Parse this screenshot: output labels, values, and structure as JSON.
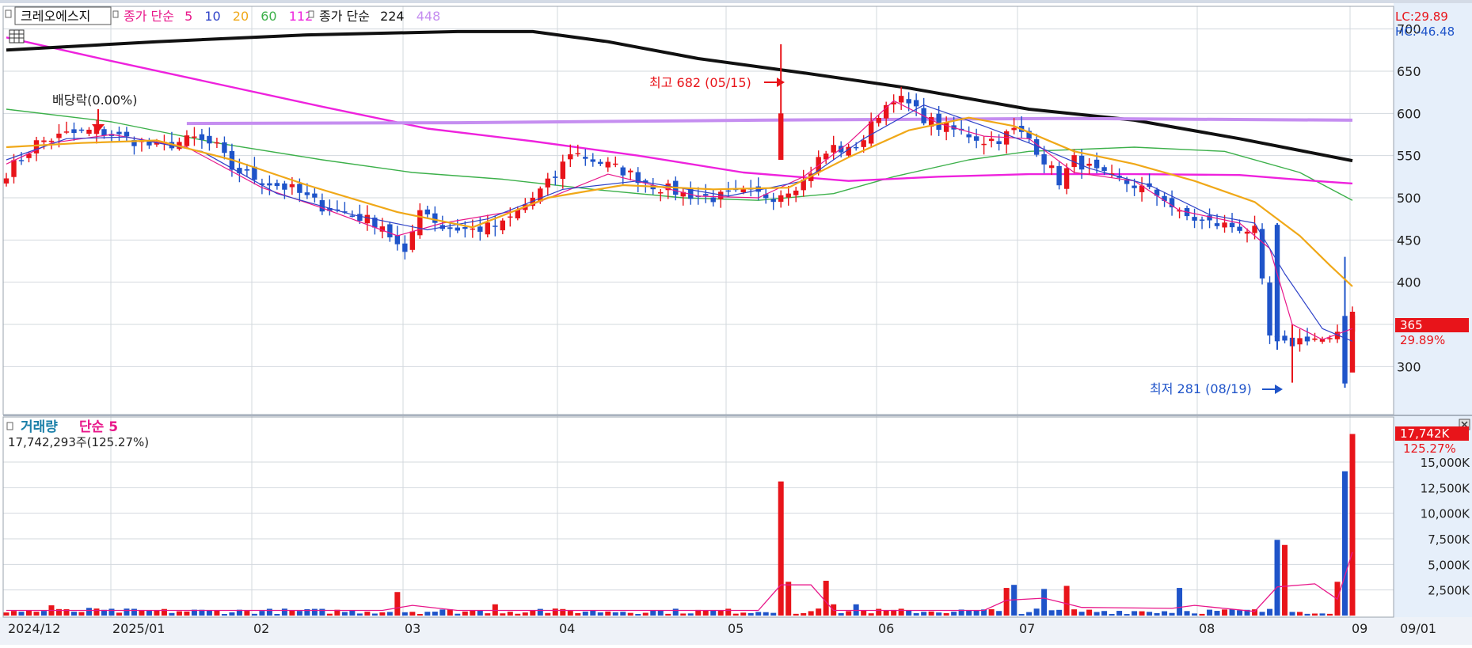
{
  "price_panel": {
    "stock_name": "크레오에스지",
    "ma_label_1": "종가 단순",
    "ma_periods_1": [
      "5",
      "10",
      "20",
      "60",
      "112"
    ],
    "ma_label_2": "종가 단순",
    "ma_periods_2": [
      "224",
      "448"
    ],
    "lc_label": "LC:29.89",
    "hc_label": "HC:-46.48",
    "dividend_label": "배당락(0.00%)",
    "high_label": "최고 682 (05/15)",
    "low_label": "최저 281 (08/19)",
    "current_price": "365",
    "current_change": "29.89%"
  },
  "volume_panel": {
    "title": "거래량",
    "ma_label": "단순 5",
    "summary": "17,742,293주(125.27%)",
    "current_volume": "17,742K",
    "current_ratio": "125.27%"
  },
  "colors": {
    "up": "#e8141a",
    "down": "#1f54c9",
    "ma5": "#e8178a",
    "ma10": "#2f43c8",
    "ma20": "#f0a818",
    "ma60": "#3cb04a",
    "ma112": "#ee22dd",
    "ma224": "#111111",
    "ma448": "#c58ef0"
  },
  "chart_data": [
    {
      "type": "candlestick",
      "title": "크레오에스지",
      "y_ticks": [
        300,
        350,
        400,
        450,
        500,
        550,
        600,
        650,
        700
      ],
      "y_tick_labels": [
        "300",
        "",
        "400",
        "450",
        "500",
        "550",
        "600",
        "650",
        "700"
      ],
      "ylim": [
        245,
        725
      ],
      "x_tick_labels": [
        "2024/12",
        "2025/01",
        "02",
        "03",
        "04",
        "05",
        "06",
        "07",
        "08",
        "09",
        "09/01"
      ],
      "grid": true,
      "bars": 180,
      "price_anchors": [
        [
          0,
          530
        ],
        [
          4,
          565
        ],
        [
          8,
          575
        ],
        [
          12,
          580
        ],
        [
          16,
          570
        ],
        [
          20,
          560
        ],
        [
          25,
          570
        ],
        [
          28,
          560
        ],
        [
          30,
          535
        ],
        [
          34,
          520
        ],
        [
          38,
          510
        ],
        [
          42,
          490
        ],
        [
          46,
          480
        ],
        [
          50,
          468
        ],
        [
          53,
          430
        ],
        [
          55,
          490
        ],
        [
          58,
          465
        ],
        [
          62,
          462
        ],
        [
          66,
          468
        ],
        [
          70,
          500
        ],
        [
          73,
          525
        ],
        [
          75,
          555
        ],
        [
          78,
          545
        ],
        [
          82,
          532
        ],
        [
          86,
          515
        ],
        [
          90,
          505
        ],
        [
          94,
          500
        ],
        [
          98,
          505
        ],
        [
          102,
          502
        ],
        [
          106,
          520
        ],
        [
          108,
          545
        ],
        [
          110,
          560
        ],
        [
          112,
          555
        ],
        [
          114,
          570
        ],
        [
          116,
          600
        ],
        [
          118,
          620
        ],
        [
          120,
          610
        ],
        [
          122,
          595
        ],
        [
          124,
          585
        ],
        [
          126,
          580
        ],
        [
          128,
          575
        ],
        [
          130,
          568
        ],
        [
          132,
          570
        ],
        [
          134,
          580
        ],
        [
          136,
          570
        ],
        [
          138,
          545
        ],
        [
          140,
          520
        ],
        [
          142,
          545
        ],
        [
          146,
          525
        ],
        [
          150,
          515
        ],
        [
          154,
          500
        ],
        [
          156,
          480
        ],
        [
          160,
          470
        ],
        [
          164,
          465
        ],
        [
          166,
          460
        ],
        [
          168,
          335
        ],
        [
          170,
          325
        ],
        [
          173,
          335
        ],
        [
          176,
          330
        ],
        [
          178,
          340
        ],
        [
          179,
          365
        ]
      ],
      "series": [
        {
          "name": "5",
          "values": [
            [
              0,
              540
            ],
            [
              6,
              565
            ],
            [
              14,
              575
            ],
            [
              24,
              560
            ],
            [
              34,
              512
            ],
            [
              42,
              488
            ],
            [
              52,
              455
            ],
            [
              58,
              470
            ],
            [
              68,
              485
            ],
            [
              80,
              528
            ],
            [
              92,
              502
            ],
            [
              100,
              500
            ],
            [
              106,
              525
            ],
            [
              112,
              565
            ],
            [
              118,
              615
            ],
            [
              124,
              588
            ],
            [
              130,
              573
            ],
            [
              136,
              570
            ],
            [
              142,
              530
            ],
            [
              150,
              520
            ],
            [
              156,
              485
            ],
            [
              164,
              470
            ],
            [
              168,
              440
            ],
            [
              171,
              350
            ],
            [
              175,
              332
            ],
            [
              179,
              345
            ]
          ]
        },
        {
          "name": "10",
          "values": [
            [
              0,
              545
            ],
            [
              8,
              570
            ],
            [
              16,
              572
            ],
            [
              26,
              555
            ],
            [
              36,
              505
            ],
            [
              46,
              480
            ],
            [
              56,
              462
            ],
            [
              64,
              475
            ],
            [
              74,
              510
            ],
            [
              84,
              520
            ],
            [
              96,
              502
            ],
            [
              106,
              520
            ],
            [
              114,
              570
            ],
            [
              122,
              610
            ],
            [
              130,
              585
            ],
            [
              136,
              565
            ],
            [
              144,
              535
            ],
            [
              152,
              515
            ],
            [
              160,
              480
            ],
            [
              166,
              470
            ],
            [
              170,
              410
            ],
            [
              175,
              345
            ],
            [
              179,
              330
            ]
          ]
        },
        {
          "name": "20",
          "values": [
            [
              0,
              560
            ],
            [
              10,
              565
            ],
            [
              20,
              568
            ],
            [
              30,
              545
            ],
            [
              40,
              515
            ],
            [
              52,
              483
            ],
            [
              62,
              465
            ],
            [
              72,
              500
            ],
            [
              82,
              515
            ],
            [
              94,
              510
            ],
            [
              104,
              512
            ],
            [
              112,
              548
            ],
            [
              120,
              580
            ],
            [
              128,
              595
            ],
            [
              134,
              585
            ],
            [
              142,
              555
            ],
            [
              150,
              540
            ],
            [
              158,
              520
            ],
            [
              166,
              495
            ],
            [
              172,
              455
            ],
            [
              176,
              420
            ],
            [
              179,
              395
            ]
          ]
        },
        {
          "name": "60",
          "values": [
            [
              0,
              605
            ],
            [
              14,
              590
            ],
            [
              28,
              565
            ],
            [
              42,
              545
            ],
            [
              54,
              530
            ],
            [
              66,
              522
            ],
            [
              78,
              510
            ],
            [
              90,
              500
            ],
            [
              100,
              497
            ],
            [
              110,
              505
            ],
            [
              118,
              525
            ],
            [
              128,
              545
            ],
            [
              136,
              555
            ],
            [
              150,
              560
            ],
            [
              162,
              555
            ],
            [
              172,
              530
            ],
            [
              179,
              497
            ]
          ]
        },
        {
          "name": "112",
          "values": [
            [
              0,
              690
            ],
            [
              14,
              662
            ],
            [
              28,
              635
            ],
            [
              42,
              608
            ],
            [
              56,
              582
            ],
            [
              70,
              567
            ],
            [
              84,
              550
            ],
            [
              98,
              530
            ],
            [
              112,
              520
            ],
            [
              124,
              525
            ],
            [
              136,
              528
            ],
            [
              150,
              528
            ],
            [
              164,
              527
            ],
            [
              174,
              520
            ],
            [
              179,
              517
            ]
          ]
        },
        {
          "name": "224",
          "values": [
            [
              0,
              675
            ],
            [
              20,
              685
            ],
            [
              40,
              693
            ],
            [
              60,
              697
            ],
            [
              70,
              697
            ],
            [
              80,
              685
            ],
            [
              92,
              665
            ],
            [
              106,
              648
            ],
            [
              120,
              630
            ],
            [
              136,
              605
            ],
            [
              150,
              592
            ],
            [
              164,
              570
            ],
            [
              179,
              544
            ]
          ]
        },
        {
          "name": "448",
          "values": [
            [
              24,
              588
            ],
            [
              60,
              589
            ],
            [
              100,
              592
            ],
            [
              140,
              594
            ],
            [
              179,
              592
            ]
          ]
        }
      ]
    },
    {
      "type": "bar",
      "title": "거래량",
      "y_tick_labels": [
        "2,500K",
        "5,000K",
        "7,500K",
        "10,000K",
        "12,500K",
        "15,000K"
      ],
      "y_ticks": [
        2500,
        5000,
        7500,
        10000,
        12500,
        15000
      ],
      "ylim": [
        0,
        18400
      ],
      "unit": "K",
      "spikes": [
        [
          6,
          1000,
          "up"
        ],
        [
          11,
          750,
          "down"
        ],
        [
          52,
          2300,
          "up"
        ],
        [
          65,
          1100,
          "up"
        ],
        [
          71,
          650,
          "down"
        ],
        [
          103,
          13100,
          "up"
        ],
        [
          104,
          3300,
          "up"
        ],
        [
          109,
          3400,
          "up"
        ],
        [
          110,
          1100,
          "up"
        ],
        [
          113,
          1100,
          "down"
        ],
        [
          133,
          2700,
          "up"
        ],
        [
          134,
          3000,
          "down"
        ],
        [
          138,
          2600,
          "down"
        ],
        [
          141,
          2900,
          "up"
        ],
        [
          156,
          2700,
          "down"
        ],
        [
          169,
          7400,
          "down"
        ],
        [
          170,
          6900,
          "up"
        ],
        [
          177,
          3300,
          "up"
        ],
        [
          178,
          14100,
          "down"
        ],
        [
          179,
          17742,
          "up"
        ]
      ],
      "series": [
        {
          "name": "단순 5",
          "values": [
            [
              0,
              500
            ],
            [
              50,
              500
            ],
            [
              54,
              1000
            ],
            [
              60,
              500
            ],
            [
              100,
              500
            ],
            [
              103,
              3000
            ],
            [
              107,
              3000
            ],
            [
              110,
              500
            ],
            [
              130,
              500
            ],
            [
              133,
              1500
            ],
            [
              138,
              1700
            ],
            [
              143,
              800
            ],
            [
              155,
              700
            ],
            [
              158,
              1000
            ],
            [
              166,
              400
            ],
            [
              169,
              2800
            ],
            [
              174,
              3100
            ],
            [
              177,
              1600
            ],
            [
              179,
              6200
            ]
          ]
        }
      ]
    }
  ]
}
